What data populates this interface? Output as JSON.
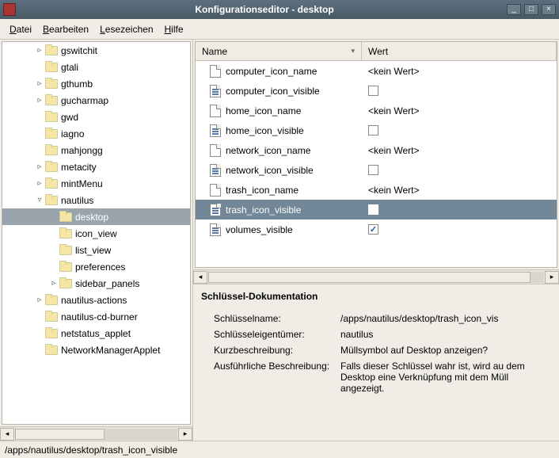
{
  "window": {
    "title": "Konfigurationseditor - desktop"
  },
  "menu": {
    "datei": "Datei",
    "bearbeiten": "Bearbeiten",
    "lesezeichen": "Lesezeichen",
    "hilfe": "Hilfe"
  },
  "tree": [
    {
      "d": 2,
      "exp": "▹",
      "label": "gswitchit"
    },
    {
      "d": 2,
      "exp": "",
      "label": "gtali"
    },
    {
      "d": 2,
      "exp": "▹",
      "label": "gthumb"
    },
    {
      "d": 2,
      "exp": "▹",
      "label": "gucharmap"
    },
    {
      "d": 2,
      "exp": "",
      "label": "gwd"
    },
    {
      "d": 2,
      "exp": "",
      "label": "iagno"
    },
    {
      "d": 2,
      "exp": "",
      "label": "mahjongg"
    },
    {
      "d": 2,
      "exp": "▹",
      "label": "metacity"
    },
    {
      "d": 2,
      "exp": "▹",
      "label": "mintMenu"
    },
    {
      "d": 2,
      "exp": "▿",
      "label": "nautilus"
    },
    {
      "d": 3,
      "exp": "",
      "label": "desktop",
      "sel": true
    },
    {
      "d": 3,
      "exp": "",
      "label": "icon_view"
    },
    {
      "d": 3,
      "exp": "",
      "label": "list_view"
    },
    {
      "d": 3,
      "exp": "",
      "label": "preferences"
    },
    {
      "d": 3,
      "exp": "▹",
      "label": "sidebar_panels"
    },
    {
      "d": 2,
      "exp": "▹",
      "label": "nautilus-actions"
    },
    {
      "d": 2,
      "exp": "",
      "label": "nautilus-cd-burner"
    },
    {
      "d": 2,
      "exp": "",
      "label": "netstatus_applet"
    },
    {
      "d": 2,
      "exp": "",
      "label": "NetworkManagerApplet"
    }
  ],
  "cols": {
    "name": "Name",
    "wert": "Wert"
  },
  "novalue": "<kein Wert>",
  "rows": [
    {
      "icon": "",
      "name": "computer_icon_name",
      "type": "str"
    },
    {
      "icon": "b",
      "name": "computer_icon_visible",
      "type": "bool",
      "checked": false
    },
    {
      "icon": "",
      "name": "home_icon_name",
      "type": "str"
    },
    {
      "icon": "b",
      "name": "home_icon_visible",
      "type": "bool",
      "checked": false
    },
    {
      "icon": "",
      "name": "network_icon_name",
      "type": "str"
    },
    {
      "icon": "b",
      "name": "network_icon_visible",
      "type": "bool",
      "checked": false
    },
    {
      "icon": "",
      "name": "trash_icon_name",
      "type": "str"
    },
    {
      "icon": "b",
      "name": "trash_icon_visible",
      "type": "bool",
      "checked": false,
      "sel": true
    },
    {
      "icon": "b",
      "name": "volumes_visible",
      "type": "bool",
      "checked": true
    }
  ],
  "doc": {
    "title": "Schlüssel-Dokumentation",
    "k_name": "Schlüsselname:",
    "v_name": "/apps/nautilus/desktop/trash_icon_vis",
    "k_owner": "Schlüsseleigentümer:",
    "v_owner": "nautilus",
    "k_short": "Kurzbeschreibung:",
    "v_short": "Müllsymbol auf Desktop anzeigen?",
    "k_long": "Ausführliche Beschreibung:",
    "v_long": "Falls dieser Schlüssel wahr ist, wird au dem Desktop eine Verknüpfung mit dem Müll angezeigt."
  },
  "status": "/apps/nautilus/desktop/trash_icon_visible"
}
